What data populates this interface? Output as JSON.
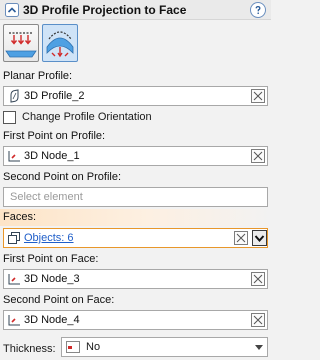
{
  "panel": {
    "title": "3D Profile Projection to Face"
  },
  "fields": {
    "planar_profile_label": "Planar Profile:",
    "planar_profile_value": "3D Profile_2",
    "change_orientation_label": "Change Profile Orientation",
    "change_orientation_checked": false,
    "first_point_profile_label": "First Point on Profile:",
    "first_point_profile_value": "3D Node_1",
    "second_point_profile_label": "Second Point on Profile:",
    "second_point_profile_placeholder": "Select element",
    "faces_label": "Faces:",
    "faces_value": "Objects: 6",
    "first_point_face_label": "First Point on Face:",
    "first_point_face_value": "3D Node_3",
    "second_point_face_label": "Second Point on Face:",
    "second_point_face_value": "3D Node_4",
    "thickness_label": "Thickness:",
    "thickness_value": "No"
  },
  "icons": {
    "title_collapse": "chevron-up-icon",
    "help": "help-icon",
    "mode_1": "projection-direction-icon",
    "mode_2": "projection-normal-icon",
    "profile": "profile-icon",
    "node": "node-icon",
    "faces": "faces-icon",
    "thickness": "thickness-icon",
    "clear": "clear-icon",
    "dropdown": "chevron-down-icon"
  },
  "colors": {
    "active_field_border": "#e8972b",
    "link": "#1f5ec9",
    "selected_mode_bg": "#cfe3f7"
  }
}
